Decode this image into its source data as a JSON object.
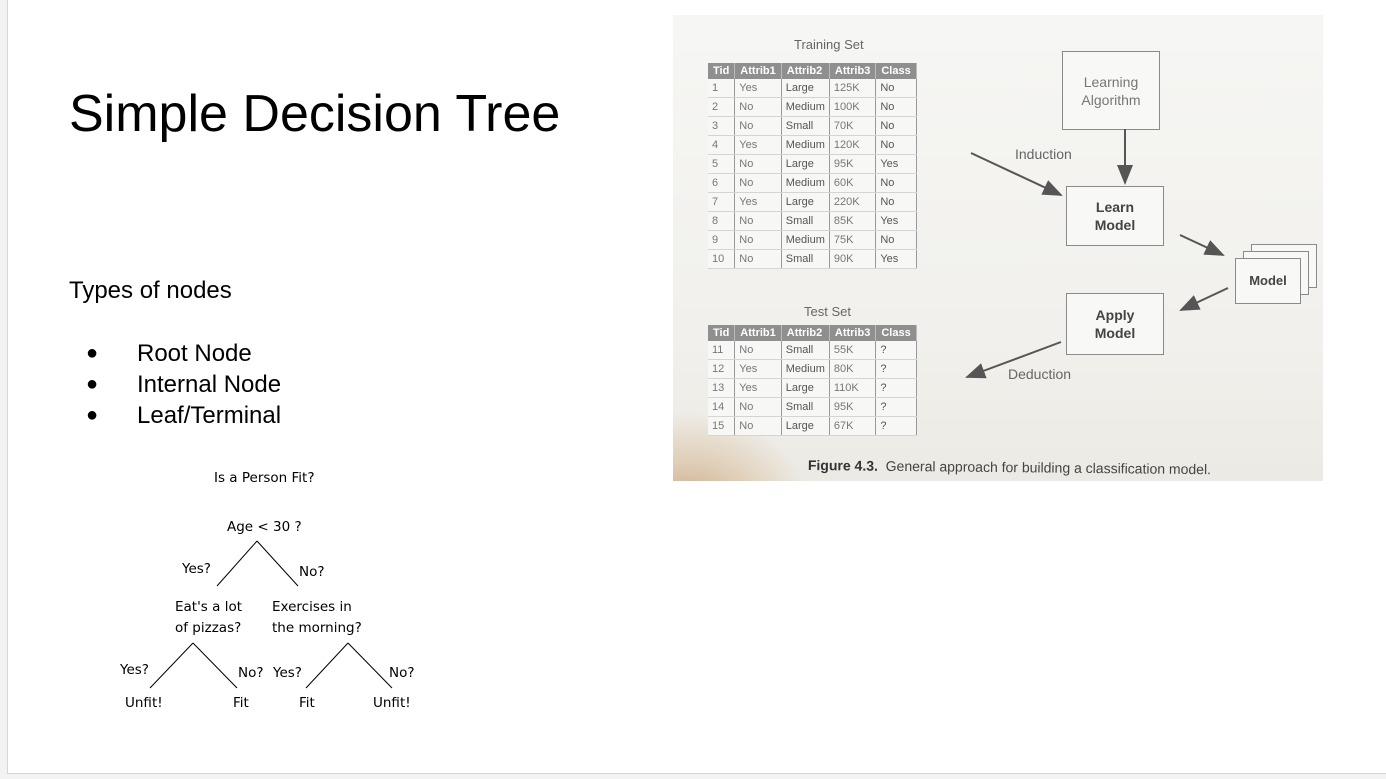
{
  "slide": {
    "title": "Simple Decision Tree",
    "subtitle": "Types of nodes",
    "bullets": [
      "Root Node",
      "Internal Node",
      "Leaf/Terminal"
    ],
    "bullet_symbol": "●"
  },
  "tree": {
    "question": "Is a Person Fit?",
    "root": "Age < 30 ?",
    "root_yes": "Yes?",
    "root_no": "No?",
    "left_node_line1": "Eat's a lot",
    "left_node_line2": "of pizzas?",
    "right_node_line1": "Exercises in",
    "right_node_line2": "the morning?",
    "left_yes": "Yes?",
    "left_no": "No?",
    "right_yes": "Yes?",
    "right_no": "No?",
    "leaves": [
      "Unfit!",
      "Fit",
      "Fit",
      "Unfit!"
    ]
  },
  "figure": {
    "training_title": "Training Set",
    "test_title": "Test Set",
    "columns": [
      "Tid",
      "Attrib1",
      "Attrib2",
      "Attrib3",
      "Class"
    ],
    "training_rows": [
      [
        "1",
        "Yes",
        "Large",
        "125K",
        "No"
      ],
      [
        "2",
        "No",
        "Medium",
        "100K",
        "No"
      ],
      [
        "3",
        "No",
        "Small",
        "70K",
        "No"
      ],
      [
        "4",
        "Yes",
        "Medium",
        "120K",
        "No"
      ],
      [
        "5",
        "No",
        "Large",
        "95K",
        "Yes"
      ],
      [
        "6",
        "No",
        "Medium",
        "60K",
        "No"
      ],
      [
        "7",
        "Yes",
        "Large",
        "220K",
        "No"
      ],
      [
        "8",
        "No",
        "Small",
        "85K",
        "Yes"
      ],
      [
        "9",
        "No",
        "Medium",
        "75K",
        "No"
      ],
      [
        "10",
        "No",
        "Small",
        "90K",
        "Yes"
      ]
    ],
    "test_rows": [
      [
        "11",
        "No",
        "Small",
        "55K",
        "?"
      ],
      [
        "12",
        "Yes",
        "Medium",
        "80K",
        "?"
      ],
      [
        "13",
        "Yes",
        "Large",
        "110K",
        "?"
      ],
      [
        "14",
        "No",
        "Small",
        "95K",
        "?"
      ],
      [
        "15",
        "No",
        "Large",
        "67K",
        "?"
      ]
    ],
    "learning_algorithm": "Learning\nAlgorithm",
    "learn_model": "Learn\nModel",
    "apply_model": "Apply\nModel",
    "model": "Model",
    "induction": "Induction",
    "deduction": "Deduction",
    "caption_label": "Figure 4.3.",
    "caption_text": "General approach for building a classification model."
  }
}
